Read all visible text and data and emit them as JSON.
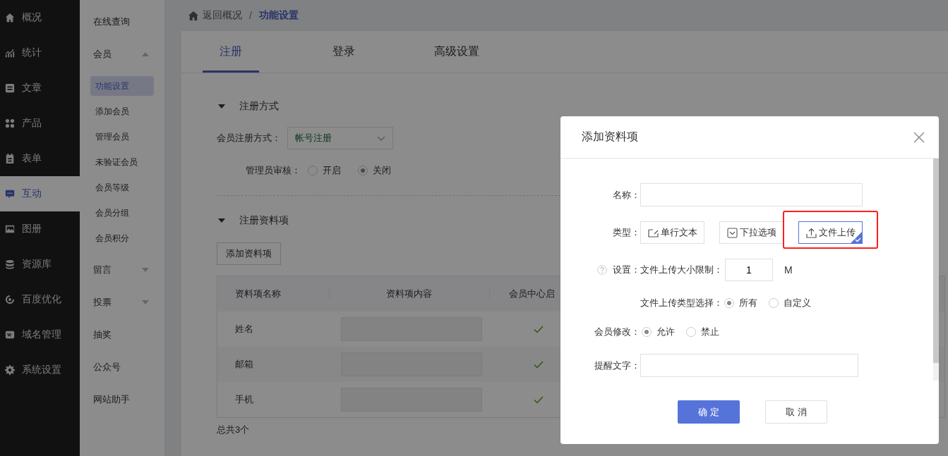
{
  "sidebar": {
    "items": [
      {
        "label": "概况",
        "selected": false
      },
      {
        "label": "统计",
        "selected": false
      },
      {
        "label": "文章",
        "selected": false
      },
      {
        "label": "产品",
        "selected": false
      },
      {
        "label": "表单",
        "selected": false
      },
      {
        "label": "互动",
        "selected": true
      },
      {
        "label": "图册",
        "selected": false
      },
      {
        "label": "资源库",
        "selected": false
      },
      {
        "label": "百度优化",
        "selected": false
      },
      {
        "label": "域名管理",
        "selected": false
      },
      {
        "label": "系统设置",
        "selected": false
      }
    ]
  },
  "subnav": {
    "items": [
      {
        "label": "在线查询"
      },
      {
        "label": "会员",
        "expanded": true,
        "children": [
          {
            "label": "功能设置",
            "selected": true
          },
          {
            "label": "添加会员",
            "selected": false
          },
          {
            "label": "管理会员",
            "selected": false
          },
          {
            "label": "未验证会员",
            "selected": false
          },
          {
            "label": "会员等级",
            "selected": false
          },
          {
            "label": "会员分组",
            "selected": false
          },
          {
            "label": "会员积分",
            "selected": false
          }
        ]
      },
      {
        "label": "留言",
        "expanded": false
      },
      {
        "label": "投票",
        "expanded": false
      },
      {
        "label": "抽奖"
      },
      {
        "label": "公众号"
      },
      {
        "label": "网站助手"
      }
    ]
  },
  "breadcrumb": {
    "back": "返回概况",
    "separator": "/",
    "current": "功能设置"
  },
  "tabs": [
    {
      "label": "注册",
      "selected": true
    },
    {
      "label": "登录",
      "selected": false
    },
    {
      "label": "高级设置",
      "selected": false
    }
  ],
  "registration_method": {
    "title": "注册方式",
    "expanded": true,
    "method_label": "会员注册方式：",
    "method_value": "帐号注册",
    "review_label": "管理员审核：",
    "review_options": [
      {
        "label": "开启",
        "selected": false
      },
      {
        "label": "关闭",
        "selected": true
      }
    ]
  },
  "registration_fields": {
    "title": "注册资料项",
    "expanded": true,
    "add_button": "添加资料项",
    "table": {
      "columns": [
        "资料项名称",
        "资料项内容",
        "会员中心启"
      ],
      "rows": [
        {
          "name": "姓名",
          "enabled": true
        },
        {
          "name": "邮箱",
          "enabled": true
        },
        {
          "name": "手机",
          "enabled": true
        }
      ]
    },
    "total": "总共3个"
  },
  "dialog": {
    "title": "添加资料项",
    "name_label": "名称：",
    "type_label": "类型：",
    "types": [
      {
        "label": "单行文本",
        "selected": false,
        "highlighted": false
      },
      {
        "label": "下拉选项",
        "selected": false,
        "highlighted": false
      },
      {
        "label": "文件上传",
        "selected": true,
        "highlighted": true
      }
    ],
    "settings_label": "设置：",
    "size_label": "文件上传大小限制：",
    "size_value": "1",
    "size_unit": "M",
    "filetype_label": "文件上传类型选择：",
    "filetype_options": [
      {
        "label": "所有",
        "selected": true
      },
      {
        "label": "自定义",
        "selected": false
      }
    ],
    "edit_label": "会员修改：",
    "edit_options": [
      {
        "label": "允许",
        "selected": true
      },
      {
        "label": "禁止",
        "selected": false
      }
    ],
    "hint_label": "提醒文字：",
    "buttons": [
      {
        "label": "确 定",
        "kind": "primary"
      },
      {
        "label": "取 消",
        "kind": "default"
      }
    ]
  }
}
